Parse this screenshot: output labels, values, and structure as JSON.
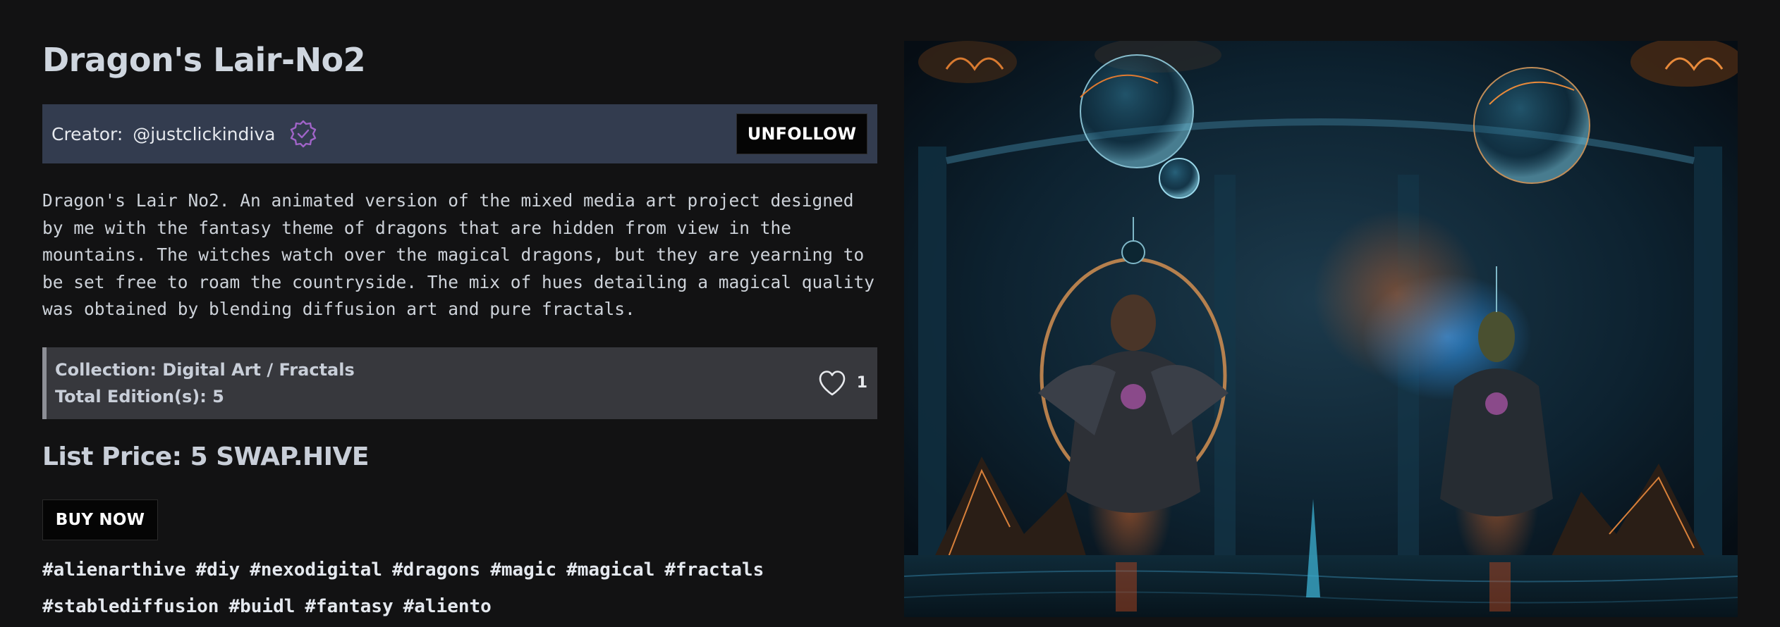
{
  "nft": {
    "title": "Dragon's Lair-No2",
    "description": "Dragon's Lair No2. An animated version of the mixed media art project designed by me with the fantasy theme of dragons that are hidden from view in the mountains. The witches watch over the magical dragons, but they are yearning to be set free to roam the countryside. The mix of hues detailing a magical quality was obtained by blending diffusion art and pure fractals.",
    "collection": "Collection: Digital Art / Fractals",
    "editions": "Total Edition(s): 5",
    "likes": "1",
    "price": "List Price: 5 SWAP.HIVE"
  },
  "creator": {
    "label": "Creator:",
    "handle": "@justclickindiva",
    "verified_icon": "verified-badge-icon"
  },
  "buttons": {
    "unfollow": "UNFOLLOW",
    "buy_now": "BUY NOW"
  },
  "tags": [
    "#alienarthive",
    "#diy",
    "#nexodigital",
    "#dragons",
    "#magic",
    "#magical",
    "#fractals",
    "#stablediffusion",
    "#buidl",
    "#fantasy",
    "#aliento"
  ],
  "colors": {
    "background": "#121213",
    "creator_bar": "#333c4f",
    "collection_bar": "#37383d",
    "button_bg": "#050505",
    "verified_accent": "#a064c8"
  }
}
